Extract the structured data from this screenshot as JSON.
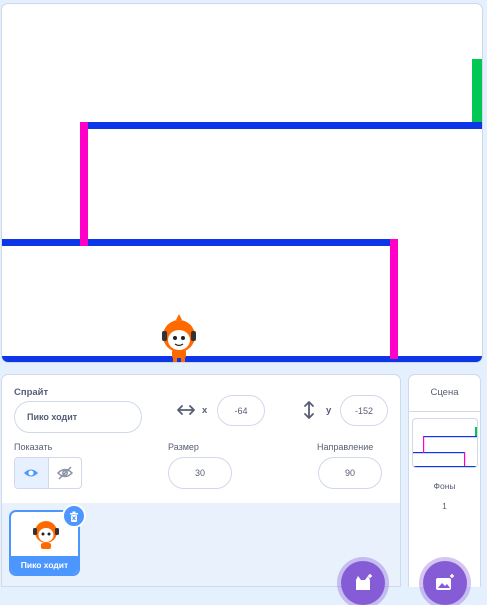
{
  "sprite_info": {
    "sprite_label": "Спрайт",
    "sprite_name": "Пико ходит",
    "x_label": "x",
    "x_value": "-64",
    "y_label": "y",
    "y_value": "-152",
    "show_label": "Показать",
    "size_label": "Размер",
    "size_value": "30",
    "direction_label": "Направление",
    "direction_value": "90"
  },
  "sprite_list": {
    "sprites": [
      {
        "name": "Пико ходит"
      }
    ]
  },
  "scene": {
    "title": "Сцена",
    "backdrops_label": "Фоны",
    "backdrops_count": "1"
  },
  "colors": {
    "platform": "#0d36e8",
    "wall": "#ff00c8",
    "goal": "#00c853",
    "accent": "#4c97ff",
    "fab": "#855cd6"
  }
}
